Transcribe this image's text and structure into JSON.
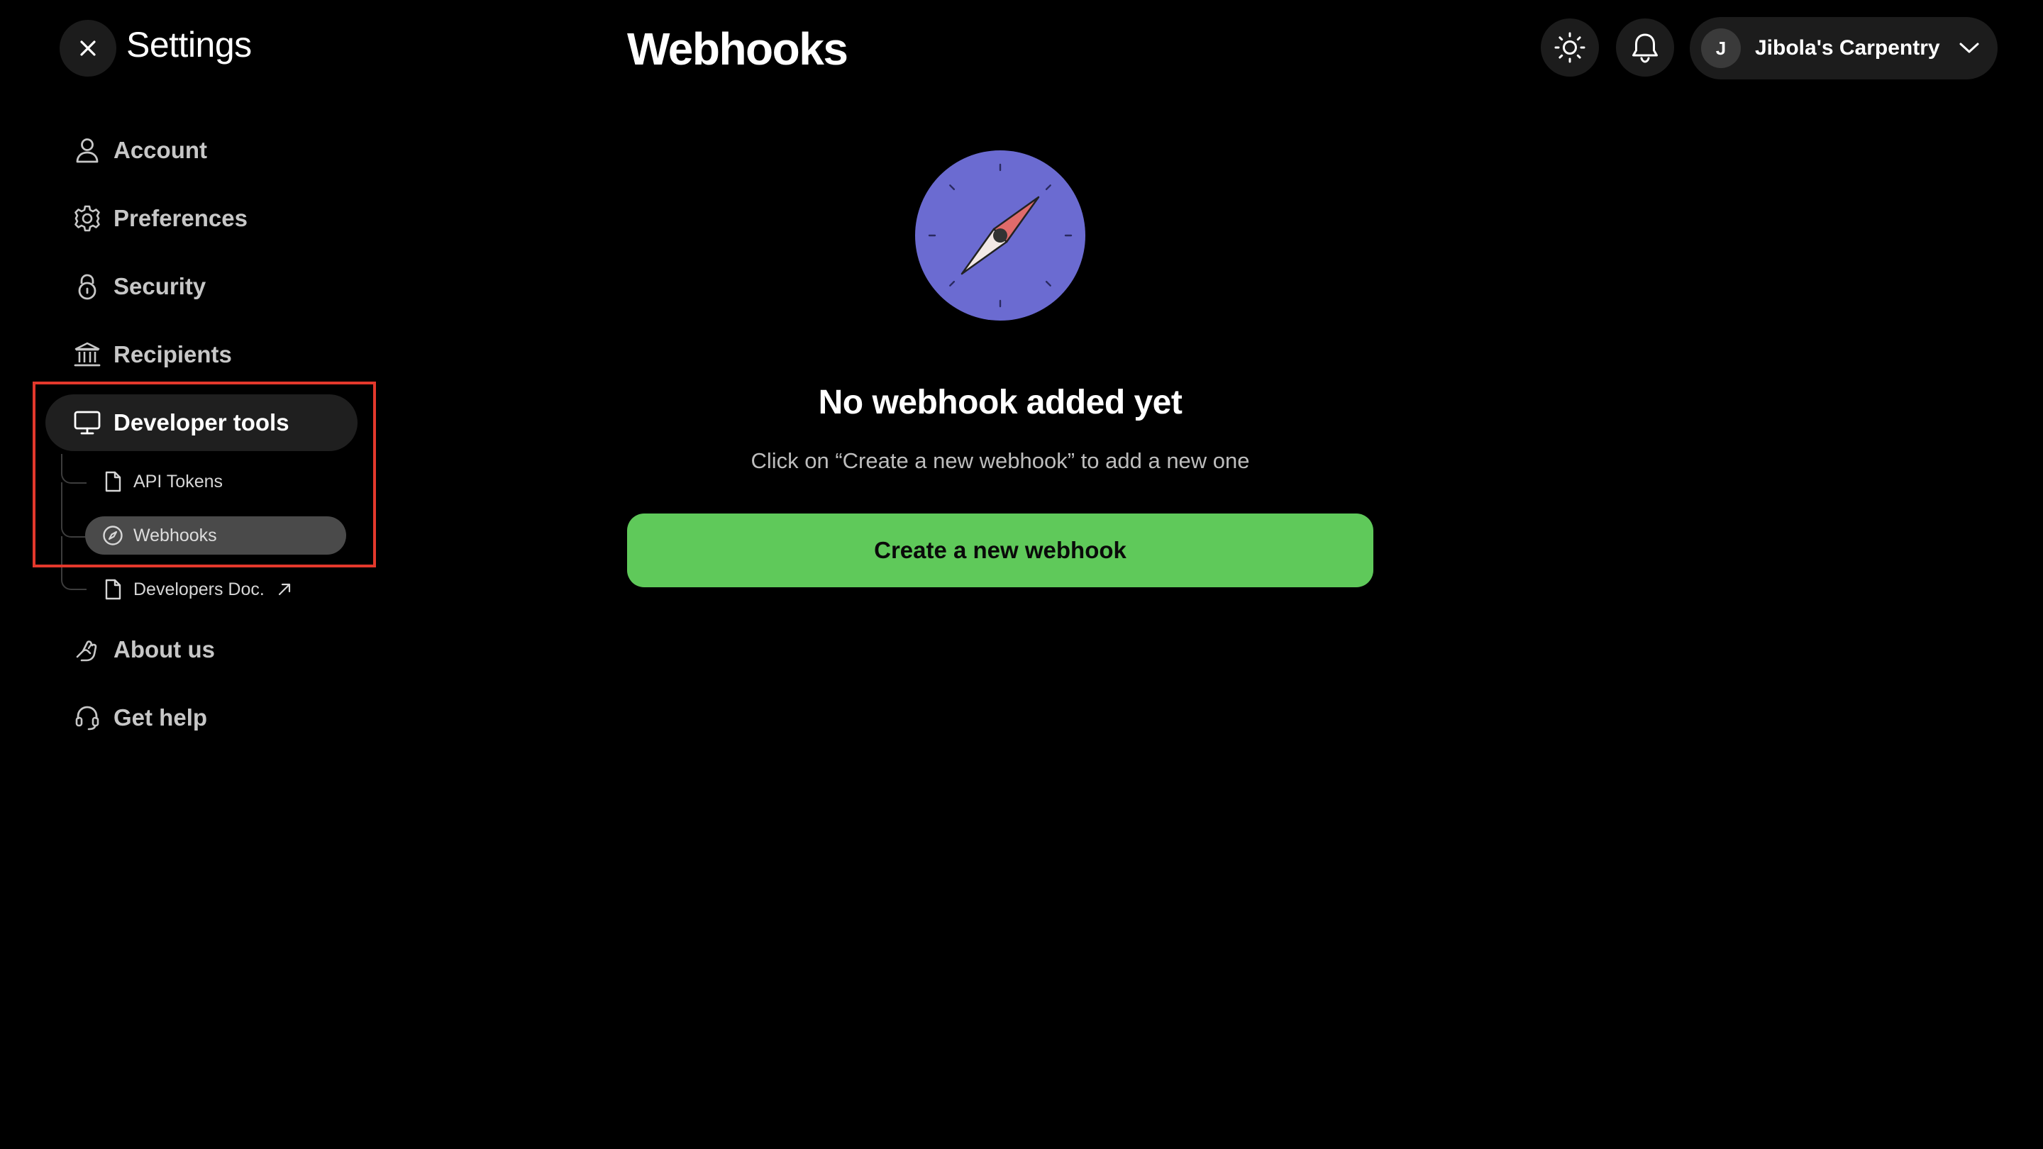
{
  "header": {
    "settings_title": "Settings",
    "page_title": "Webhooks",
    "account": {
      "avatar_initial": "J",
      "name": "Jibola's Carpentry"
    }
  },
  "sidebar": {
    "items": [
      {
        "label": "Account",
        "icon": "user-icon"
      },
      {
        "label": "Preferences",
        "icon": "gear-icon"
      },
      {
        "label": "Security",
        "icon": "lock-icon"
      },
      {
        "label": "Recipients",
        "icon": "bank-icon"
      },
      {
        "label": "Developer tools",
        "icon": "monitor-icon",
        "active": true
      },
      {
        "label": "About us",
        "icon": "hand-icon"
      },
      {
        "label": "Get help",
        "icon": "headset-icon"
      }
    ],
    "developer_subitems": [
      {
        "label": "API Tokens",
        "icon": "file-icon"
      },
      {
        "label": "Webhooks",
        "icon": "compass-icon",
        "active": true
      },
      {
        "label": "Developers Doc.",
        "icon": "file-icon",
        "external": true
      }
    ]
  },
  "main": {
    "empty_title": "No webhook added yet",
    "empty_subtitle": "Click on “Create a new webhook” to add a new one",
    "create_button": "Create a new webhook"
  },
  "colors": {
    "background": "#000000",
    "accent_green": "#5fc95a",
    "compass_purple": "#6b6bd1",
    "compass_needle_red": "#e06b6b",
    "highlight_red": "#e3382c"
  }
}
